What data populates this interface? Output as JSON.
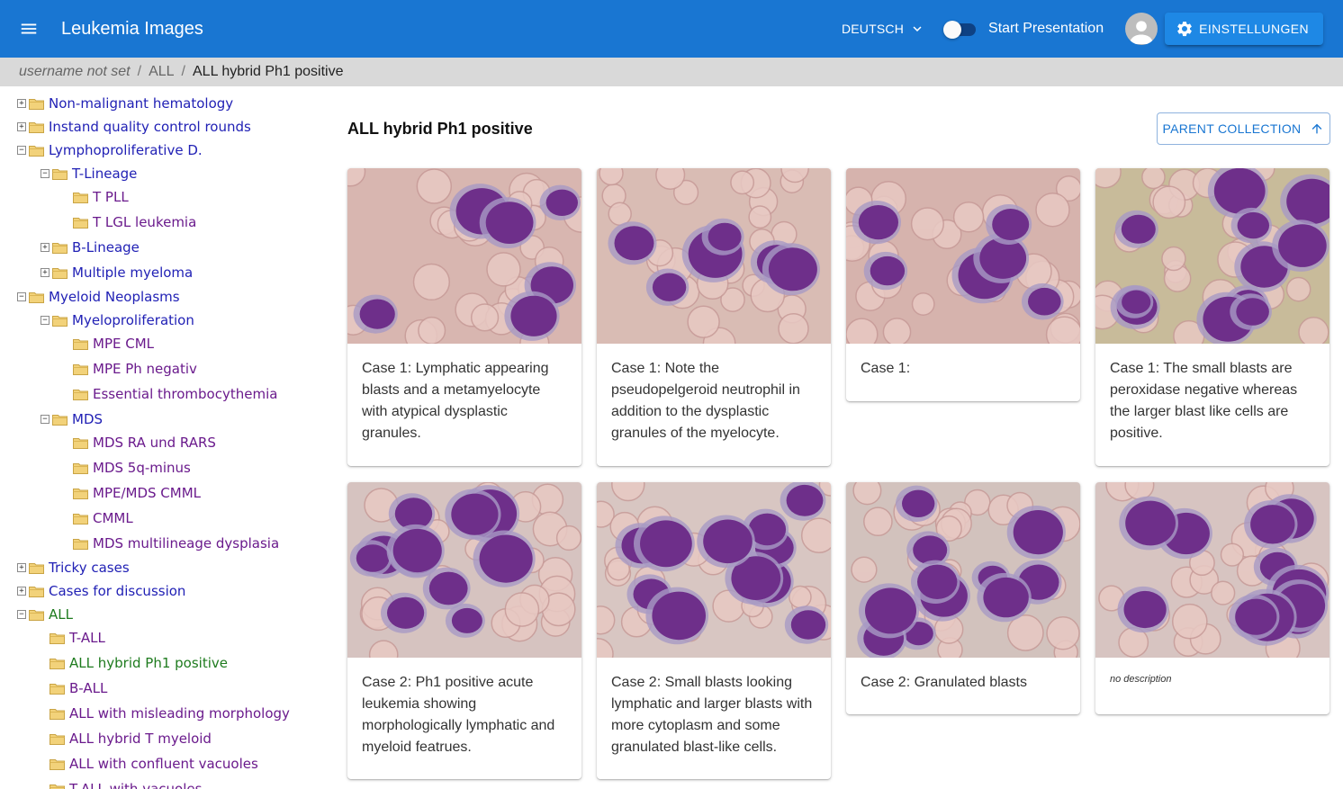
{
  "appbar": {
    "title": "Leukemia Images",
    "language": "DEUTSCH",
    "presentation_label": "Start Presentation",
    "settings_label": "EINSTELLUNGEN",
    "color": "#1976d2"
  },
  "breadcrumb": {
    "user": "username not set",
    "items": [
      "ALL",
      "ALL hybrid Ph1 positive"
    ]
  },
  "tree": [
    {
      "label": "Non-malignant hematology",
      "expander": "+",
      "color": "blue"
    },
    {
      "label": "Instand quality control rounds",
      "expander": "+",
      "color": "blue"
    },
    {
      "label": "Lymphoproliferative D.",
      "expander": "−",
      "color": "blue"
    },
    {
      "label": "T-Lineage",
      "expander": "−",
      "color": "blue"
    },
    {
      "label": "T PLL",
      "expander": "",
      "color": "purple"
    },
    {
      "label": "T LGL leukemia",
      "expander": "",
      "color": "purple"
    },
    {
      "label": "B-Lineage",
      "expander": "+",
      "color": "blue"
    },
    {
      "label": "Multiple myeloma",
      "expander": "+",
      "color": "blue"
    },
    {
      "label": "Myeloid Neoplasms",
      "expander": "−",
      "color": "blue"
    },
    {
      "label": "Myeloproliferation",
      "expander": "−",
      "color": "blue"
    },
    {
      "label": "MPE CML",
      "expander": "",
      "color": "purple"
    },
    {
      "label": "MPE Ph negativ",
      "expander": "",
      "color": "purple"
    },
    {
      "label": "Essential thrombocythemia",
      "expander": "",
      "color": "purple"
    },
    {
      "label": "MDS",
      "expander": "−",
      "color": "blue"
    },
    {
      "label": "MDS RA und RARS",
      "expander": "",
      "color": "purple"
    },
    {
      "label": "MDS 5q-minus",
      "expander": "",
      "color": "purple"
    },
    {
      "label": "MPE/MDS CMML",
      "expander": "",
      "color": "purple"
    },
    {
      "label": "CMML",
      "expander": "",
      "color": "purple"
    },
    {
      "label": "MDS multilineage dysplasia",
      "expander": "",
      "color": "purple"
    },
    {
      "label": "Tricky cases",
      "expander": "+",
      "color": "blue"
    },
    {
      "label": "Cases for discussion",
      "expander": "+",
      "color": "blue"
    },
    {
      "label": "ALL",
      "expander": "−",
      "color": "green"
    },
    {
      "label": "T-ALL",
      "expander": "",
      "color": "purple"
    },
    {
      "label": "ALL hybrid Ph1 positive",
      "expander": "",
      "color": "green"
    },
    {
      "label": "B-ALL",
      "expander": "",
      "color": "purple"
    },
    {
      "label": "ALL with misleading morphology",
      "expander": "",
      "color": "purple"
    },
    {
      "label": "ALL hybrid T myeloid",
      "expander": "",
      "color": "purple"
    },
    {
      "label": "ALL with confluent vacuoles",
      "expander": "",
      "color": "purple"
    },
    {
      "label": "T-ALL with vacuoles",
      "expander": "",
      "color": "purple"
    }
  ],
  "content": {
    "title": "ALL hybrid Ph1 positive",
    "parent_button": "PARENT COLLECTION"
  },
  "cards": [
    {
      "description": "Case 1: Lymphatic appearing blasts and a metamyelocyte with atypical dysplastic granules.",
      "bg": "#d8b6b0"
    },
    {
      "description": "Case 1: Note the pseudopelgeroid neutrophil in addition to the dysplastic granules of the myelocyte.",
      "bg": "#d9bcb4"
    },
    {
      "description": "Case 1:",
      "bg": "#d6b3ad"
    },
    {
      "description": "Case 1: The small blasts are peroxidase negative whereas the larger blast like cells are positive.",
      "bg": "#c8bb9a"
    },
    {
      "description": "Case 2: Ph1 positive acute leukemia showing morphologically lymphatic and myeloid featrues.",
      "bg": "#d6c3c0"
    },
    {
      "description": "Case 2: Small blasts looking lymphatic and larger blasts with more cytoplasm and some granulated blast-like cells.",
      "bg": "#d8c6c2"
    },
    {
      "description": "Case 2: Granulated blasts",
      "bg": "#d2c2bd"
    },
    {
      "description": "no description",
      "bg": "#d7c4c1"
    }
  ]
}
